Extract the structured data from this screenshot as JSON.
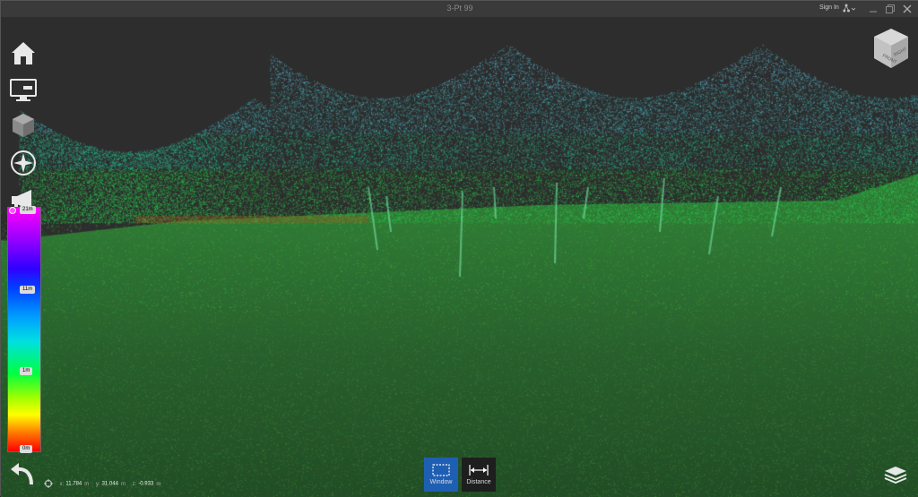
{
  "window": {
    "title": "3-Pt 99",
    "sign_in": "Sign In"
  },
  "sidebar": {
    "items": [
      {
        "name": "home",
        "icon": "home-icon"
      },
      {
        "name": "display",
        "icon": "monitor-icon"
      },
      {
        "name": "view",
        "icon": "cube-icon"
      },
      {
        "name": "navigate",
        "icon": "compass-icon"
      },
      {
        "name": "announce",
        "icon": "megaphone-icon"
      }
    ]
  },
  "legend": {
    "ticks": [
      "21m",
      "11m",
      "1m",
      "0m"
    ],
    "colors": [
      "#ff00ff",
      "#0040ff",
      "#00e0e0",
      "#00ff40",
      "#ffff00",
      "#ff0000"
    ]
  },
  "coords": {
    "x_label": "x:",
    "x_value": "11.784",
    "x_unit": "m",
    "y_label": "y:",
    "y_value": "31.044",
    "y_unit": "m",
    "z_label": "z:",
    "z_value": "-0.933",
    "z_unit": "m"
  },
  "toolbar": {
    "window_label": "Window",
    "distance_label": "Distance"
  },
  "viewcube": {
    "front": "FRONT",
    "right": "RIGHT"
  },
  "colors": {
    "accent": "#1f5fb3",
    "background": "#2d2d2d",
    "ground": "#245a2a"
  }
}
